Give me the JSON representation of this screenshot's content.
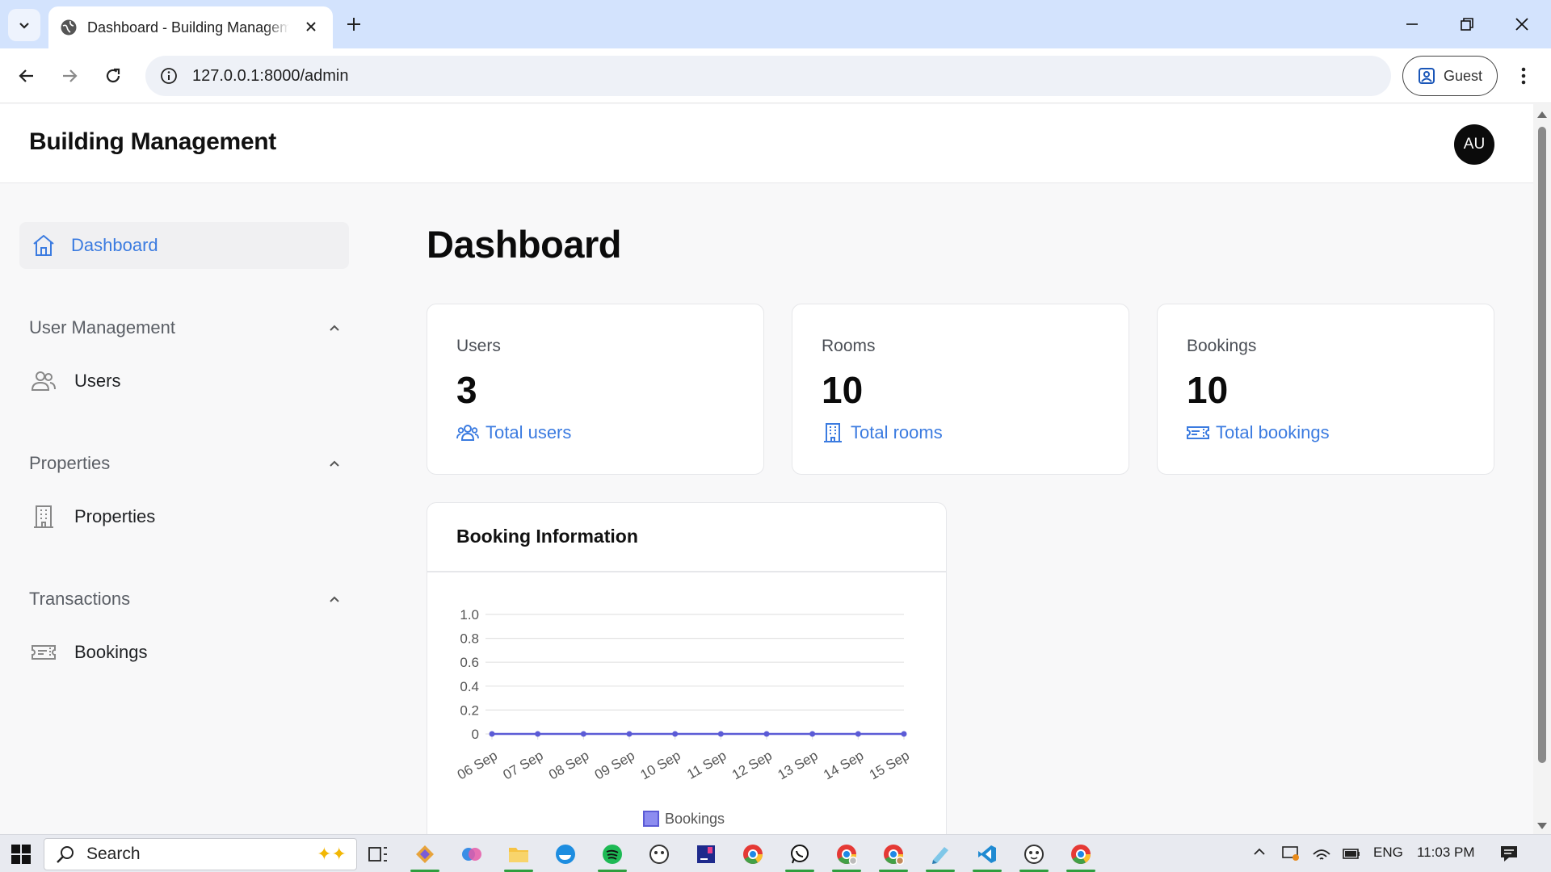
{
  "browser": {
    "tab_title": "Dashboard - Building Management",
    "url": "127.0.0.1:8000/admin",
    "profile_label": "Guest"
  },
  "app": {
    "title": "Building Management",
    "avatar_initials": "AU"
  },
  "sidebar": {
    "active_item": "Dashboard",
    "sections": [
      {
        "title": "User Management",
        "item": "Users"
      },
      {
        "title": "Properties",
        "item": "Properties"
      },
      {
        "title": "Transactions",
        "item": "Bookings"
      }
    ]
  },
  "main": {
    "page_title": "Dashboard",
    "stats": [
      {
        "label": "Users",
        "value": "3",
        "link": "Total users"
      },
      {
        "label": "Rooms",
        "value": "10",
        "link": "Total rooms"
      },
      {
        "label": "Bookings",
        "value": "10",
        "link": "Total bookings"
      }
    ],
    "chart_card_title": "Booking Information"
  },
  "chart_data": {
    "type": "line",
    "categories": [
      "06 Sep",
      "07 Sep",
      "08 Sep",
      "09 Sep",
      "10 Sep",
      "11 Sep",
      "12 Sep",
      "13 Sep",
      "14 Sep",
      "15 Sep"
    ],
    "series": [
      {
        "name": "Bookings",
        "values": [
          0,
          0,
          0,
          0,
          0,
          0,
          0,
          0,
          0,
          0
        ],
        "color": "#5b5bd6"
      }
    ],
    "y_ticks": [
      "0",
      "0.2",
      "0.4",
      "0.6",
      "0.8",
      "1.0"
    ],
    "ylim": [
      0,
      1
    ],
    "grid": true,
    "legend": "bottom"
  },
  "taskbar": {
    "search_placeholder": "Search",
    "language": "ENG",
    "time": "11:03 PM"
  },
  "colors": {
    "accent": "#3b7be0",
    "line": "#5b5bd6"
  }
}
